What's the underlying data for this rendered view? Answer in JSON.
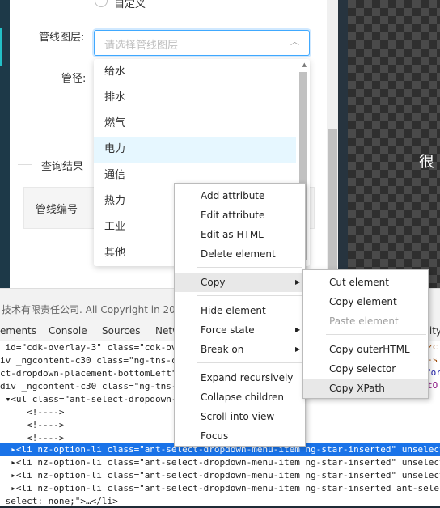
{
  "form": {
    "radio_label": "自定义",
    "layer_label": "管线图层:",
    "layer_placeholder": "请选择管线图层",
    "diameter_label": "管径:",
    "results_label": "查询结果",
    "table_header": "管线编号",
    "dropdown_options": [
      "给水",
      "排水",
      "燃气",
      "电力",
      "通信",
      "热力",
      "工业",
      "其他"
    ],
    "active_option": "电力"
  },
  "side_text": "很",
  "footer_text": "技术有限责任公司. All Copyright in 2018",
  "devtools": {
    "tabs": [
      "ements",
      "Console",
      "Sources",
      "Netw",
      "rity"
    ],
    "lines": [
      {
        "text": " id=\"cdk-overlay-3\" class=\"cdk-ov",
        "selected": false
      },
      {
        "text": "iv _ngcontent-c30 class=\"ng-tns-c",
        "selected": false
      },
      {
        "text": "ct-dropdown-placement-bottomLeft\"",
        "selected": false
      },
      {
        "text": "div _ngcontent-c30 class=\"ng-tns-",
        "selected": false
      },
      {
        "text": " ▾<ul class=\"ant-select-dropdown-m",
        "selected": false
      },
      {
        "text": "     <!---->",
        "selected": false
      },
      {
        "text": "     <!---->",
        "selected": false
      },
      {
        "text": "     <!---->",
        "selected": false
      },
      {
        "text": "  ▸<li nz-option-li class=\"ant-select-dropdown-menu-item ng-star-inserted\" unselect",
        "selected": true
      },
      {
        "text": "  ▸<li nz-option-li class=\"ant-select-dropdown-menu-item ng-star-inserted\" unselect",
        "selected": false
      },
      {
        "text": "  ▸<li nz-option-li class=\"ant-select-dropdown-menu-item ng-star-inserted\" unselect",
        "selected": false
      },
      {
        "text": "  ▸<li nz-option-li class=\"ant-select-dropdown-menu-item ng-star-inserted ant-selec",
        "selected": false
      },
      {
        "text": " select: none;\">…</li>",
        "selected": false
      }
    ],
    "right_fragments": [
      "zc",
      "-s",
      "for",
      "tO"
    ]
  },
  "context_menu": {
    "items": [
      {
        "label": "Add attribute",
        "submenu": false
      },
      {
        "label": "Edit attribute",
        "submenu": false
      },
      {
        "label": "Edit as HTML",
        "submenu": false
      },
      {
        "label": "Delete element",
        "submenu": false
      },
      {
        "label": "Copy",
        "submenu": true
      },
      {
        "label": "Hide element",
        "submenu": false
      },
      {
        "label": "Force state",
        "submenu": true
      },
      {
        "label": "Break on",
        "submenu": true
      },
      {
        "label": "Expand recursively",
        "submenu": false
      },
      {
        "label": "Collapse children",
        "submenu": false
      },
      {
        "label": "Scroll into view",
        "submenu": false
      },
      {
        "label": "Focus",
        "submenu": false
      }
    ]
  },
  "copy_submenu": {
    "items": [
      {
        "label": "Cut element",
        "disabled": false
      },
      {
        "label": "Copy element",
        "disabled": false
      },
      {
        "label": "Paste element",
        "disabled": true
      },
      {
        "label": "Copy outerHTML",
        "disabled": false
      },
      {
        "label": "Copy selector",
        "disabled": false
      },
      {
        "label": "Copy XPath",
        "disabled": false
      }
    ],
    "highlighted": "Copy XPath"
  },
  "colors": {
    "accent": "#1a73e8",
    "select_border": "#40a9ff",
    "active_option_bg": "#e6f7ff"
  },
  "icons": [
    "chevron-up-icon",
    "submenu-arrow-icon",
    "expand-triangle-icon"
  ]
}
